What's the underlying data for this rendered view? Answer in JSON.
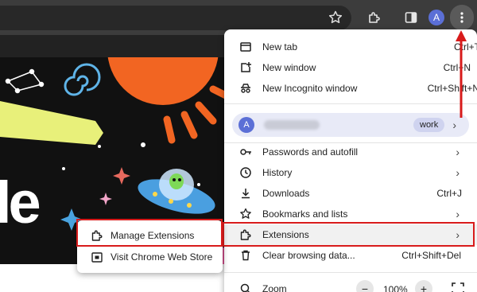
{
  "toolbar": {
    "profile_initial": "A",
    "icons": [
      "bookmark-star-icon",
      "extensions-puzzle-icon",
      "side-panel-icon",
      "kebab-menu-icon"
    ]
  },
  "page": {
    "doodle_letters": "le"
  },
  "menu": {
    "items_top": [
      {
        "label": "New tab",
        "shortcut": "Ctrl+T",
        "icon": "new-tab-icon"
      },
      {
        "label": "New window",
        "shortcut": "Ctrl+N",
        "icon": "new-window-icon"
      },
      {
        "label": "New Incognito window",
        "shortcut": "Ctrl+Shift+N",
        "icon": "incognito-icon"
      }
    ],
    "profile": {
      "initial": "A",
      "badge": "work"
    },
    "items_mid": [
      {
        "label": "Passwords and autofill",
        "icon": "key-icon"
      },
      {
        "label": "History",
        "icon": "history-icon"
      },
      {
        "label": "Downloads",
        "shortcut": "Ctrl+J",
        "icon": "download-icon"
      },
      {
        "label": "Bookmarks and lists",
        "icon": "star-icon"
      },
      {
        "label": "Extensions",
        "icon": "extensions-icon"
      },
      {
        "label": "Clear browsing data...",
        "shortcut": "Ctrl+Shift+Del",
        "icon": "trash-icon"
      }
    ],
    "zoom": {
      "label": "Zoom",
      "minus": "−",
      "value": "100%",
      "plus": "+"
    }
  },
  "submenu": {
    "items": [
      {
        "label": "Manage Extensions",
        "icon": "puzzle-icon"
      },
      {
        "label": "Visit Chrome Web Store",
        "icon": "web-store-icon"
      }
    ]
  },
  "colors": {
    "highlight": "#d81b1b",
    "toolbar": "#3c3c3c",
    "menu_bg": "#ffffff",
    "profile_bg": "#e8eaf7"
  }
}
